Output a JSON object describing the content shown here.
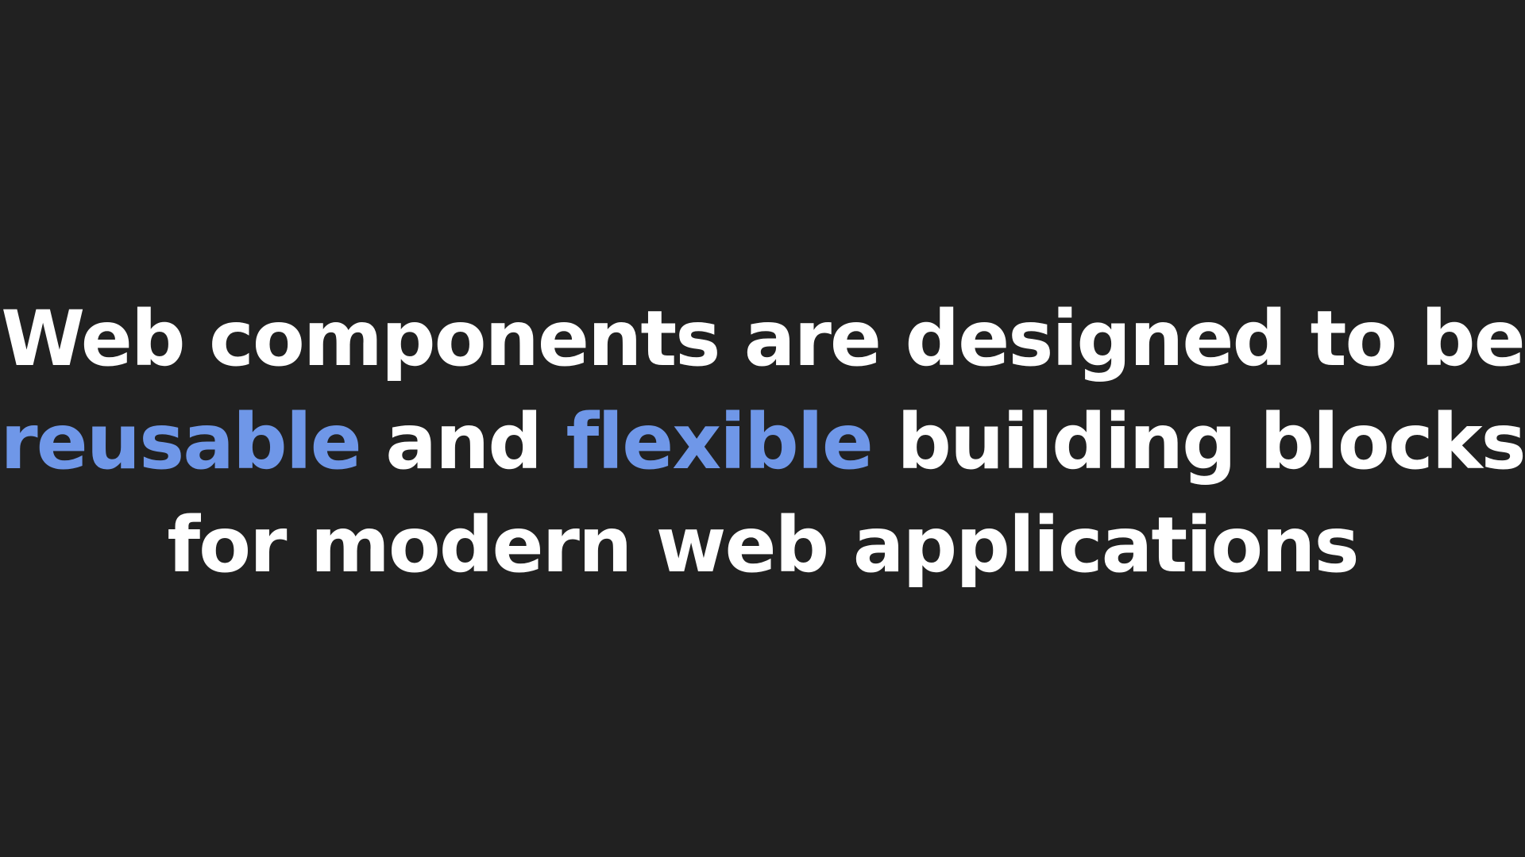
{
  "colors": {
    "background": "#212121",
    "text": "#ffffff",
    "accent": "#6f97e8"
  },
  "statement": {
    "line1": "Web components are designed to be",
    "line2_highlight1": "reusable",
    "line2_mid": " and ",
    "line2_highlight2": "flexible",
    "line2_end": " building blocks",
    "line3": "for modern web applications"
  }
}
